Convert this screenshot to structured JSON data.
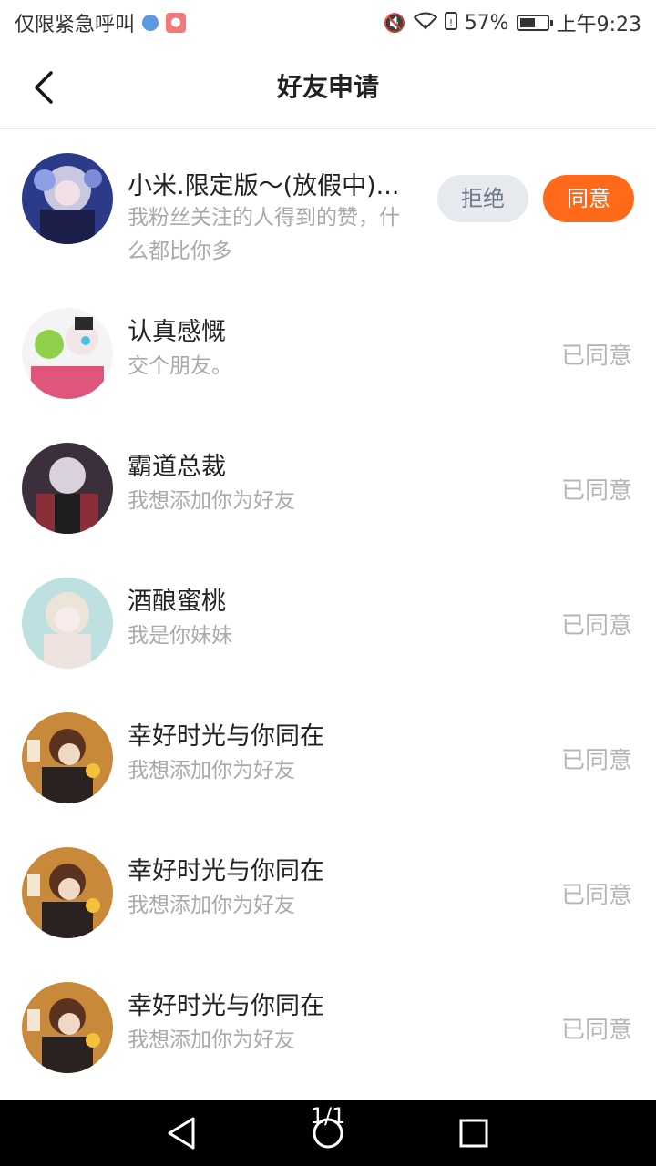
{
  "status_bar": {
    "carrier_text": "仅限紧急呼叫",
    "battery_percent": "57%",
    "battery_level": 0.57,
    "time": "上午9:23"
  },
  "header": {
    "title": "好友申请"
  },
  "requests": [
    {
      "name": "小米.限定版～(放假中)...",
      "message": "我粉丝关注的人得到的赞，什么都比你多",
      "reject_label": "拒绝",
      "accept_label": "同意"
    },
    {
      "name": "认真感慨",
      "message": "交个朋友。",
      "status": "已同意"
    },
    {
      "name": "霸道总裁",
      "message": "我想添加你为好友",
      "status": "已同意"
    },
    {
      "name": "酒酿蜜桃",
      "message": "我是你妹妹",
      "status": "已同意"
    },
    {
      "name": "幸好时光与你同在",
      "message": "我想添加你为好友",
      "status": "已同意"
    },
    {
      "name": "幸好时光与你同在",
      "message": "我想添加你为好友",
      "status": "已同意"
    },
    {
      "name": "幸好时光与你同在",
      "message": "我想添加你为好友",
      "status": "已同意"
    }
  ],
  "nav": {
    "page_indicator": "1/1"
  }
}
